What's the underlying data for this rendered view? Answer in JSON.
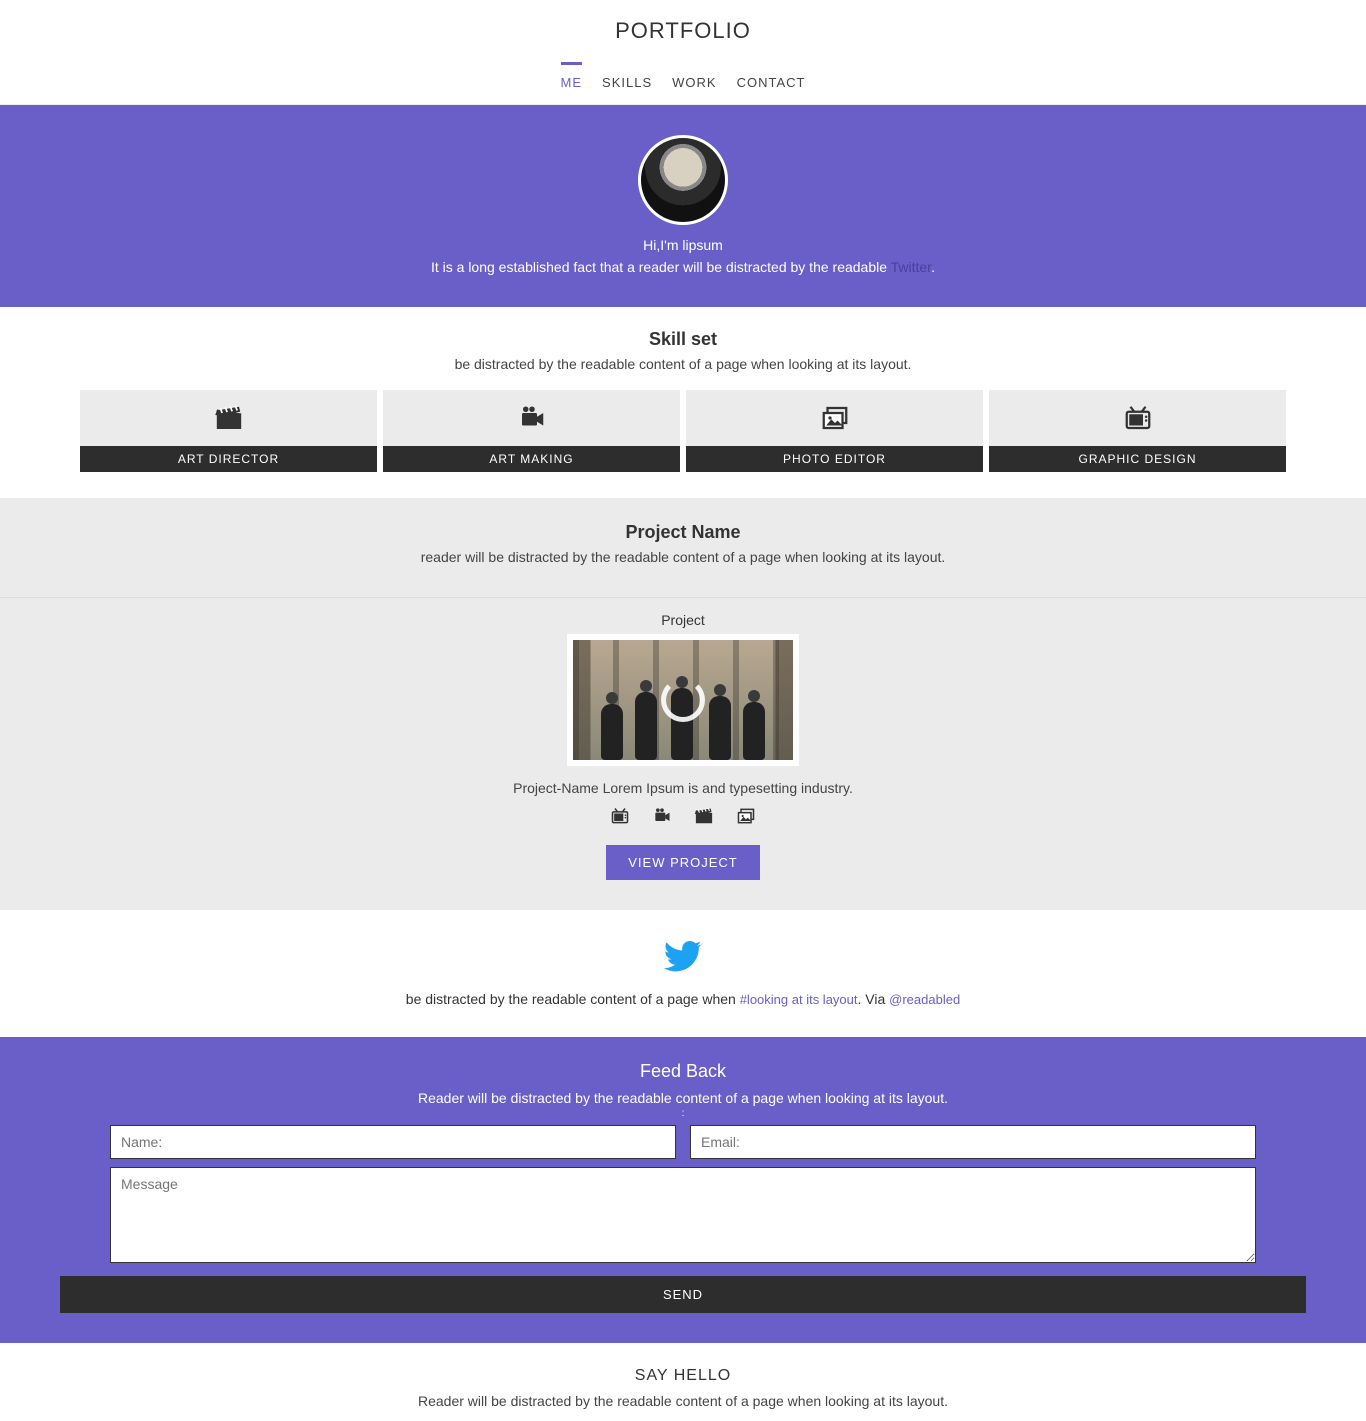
{
  "header": {
    "logo": "PORTFOLIO",
    "nav": [
      "ME",
      "SKILLS",
      "WORK",
      "CONTACT"
    ],
    "active": 0
  },
  "hero": {
    "greeting": "Hi,I'm lipsum",
    "text_before": "It is a long established fact that a reader will be distracted by the readable ",
    "link": "Twitter",
    "text_after": "."
  },
  "skills": {
    "title": "Skill set",
    "subtitle": "be distracted by the readable content of a page when looking at its layout.",
    "items": [
      {
        "label": "ART DIRECTOR",
        "icon": "clapper-icon"
      },
      {
        "label": "ART MAKING",
        "icon": "camera-icon"
      },
      {
        "label": "PHOTO EDITOR",
        "icon": "photos-icon"
      },
      {
        "label": "GRAPHIC DESIGN",
        "icon": "tv-icon"
      }
    ]
  },
  "projects": {
    "title": "Project Name",
    "subtitle": "reader will be distracted by the readable content of a page when looking at its layout.",
    "heading": "Project",
    "description": "Project-Name Lorem Ipsum is and typesetting industry.",
    "icons": [
      "tv-icon",
      "camera-icon",
      "clapper-icon",
      "photos-icon"
    ],
    "button": "VIEW PROJECT"
  },
  "tweet": {
    "text_before": "be distracted by the readable content of a page when ",
    "hashtag": "#looking at its layout",
    "middle": ". Via ",
    "handle": "@readabled"
  },
  "feedback": {
    "title": "Feed Back",
    "subtitle": "Reader will be distracted by the readable content of a page when looking at its layout.",
    "colon": ":",
    "name_placeholder": "Name:",
    "email_placeholder": "Email:",
    "message_placeholder": "Message",
    "send": "SEND"
  },
  "sayhello": {
    "title": "SAY HELLO",
    "subtitle": "Reader will be distracted by the readable content of a page when looking at its layout."
  }
}
